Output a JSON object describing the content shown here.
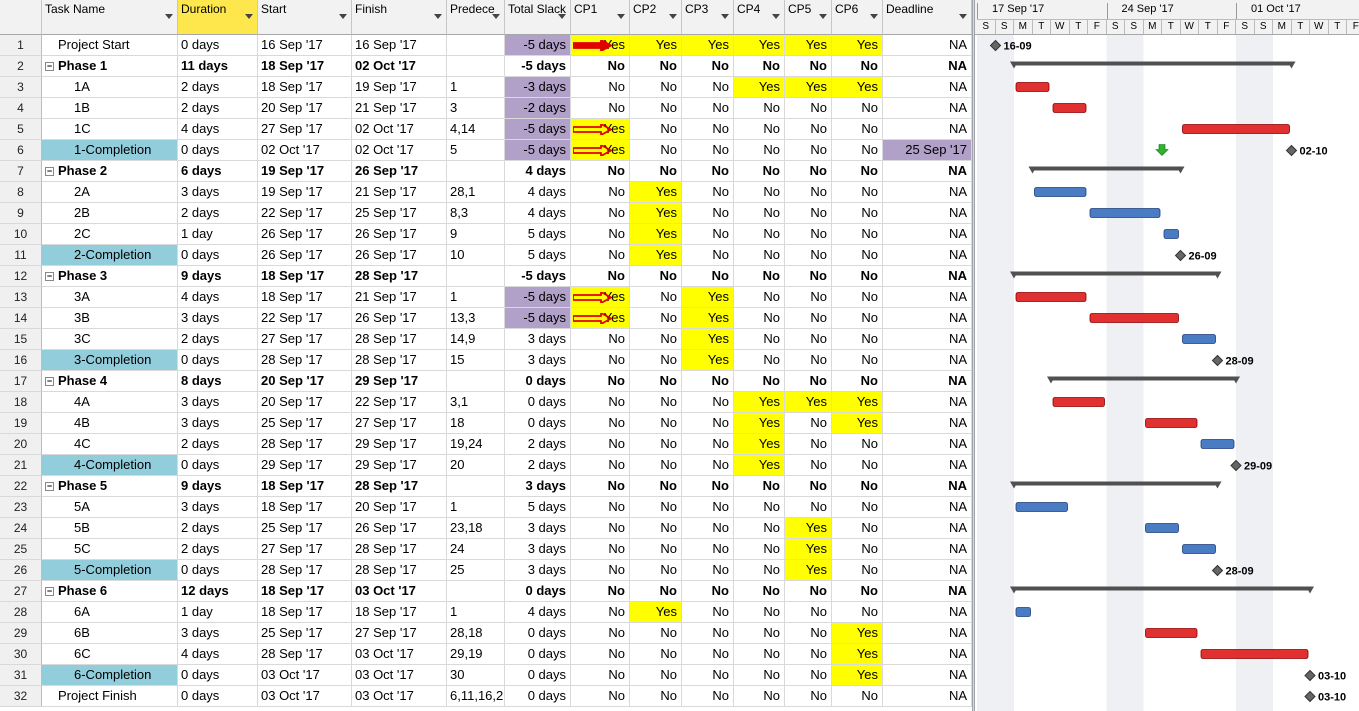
{
  "columns": {
    "id": "",
    "name": "Task Name",
    "duration": "Duration",
    "start": "Start",
    "finish": "Finish",
    "pred": "Predece",
    "slack": "Total Slack",
    "cp1": "CP1",
    "cp2": "CP2",
    "cp3": "CP3",
    "cp4": "CP4",
    "cp5": "CP5",
    "cp6": "CP6",
    "deadline": "Deadline"
  },
  "colors": {
    "yes": "#ffff00",
    "slack_negative": "#b1a0c7",
    "milestone_name": "#92cddc",
    "critical_bar": "#e03030",
    "normal_bar": "#4a7cc4",
    "summary_bar": "#505050"
  },
  "rows": [
    {
      "id": "1",
      "name": "Project Start",
      "dur": "0 days",
      "start": "16 Sep '17",
      "finish": "16 Sep '17",
      "pred": "",
      "slack": "-5 days",
      "cp": [
        "Yes",
        "Yes",
        "Yes",
        "Yes",
        "Yes",
        "Yes"
      ],
      "deadline": "NA"
    },
    {
      "id": "2",
      "name": "Phase 1",
      "dur": "11 days",
      "start": "18 Sep '17",
      "finish": "02 Oct '17",
      "pred": "",
      "slack": "-5 days",
      "cp": [
        "No",
        "No",
        "No",
        "No",
        "No",
        "No"
      ],
      "deadline": "NA"
    },
    {
      "id": "3",
      "name": "1A",
      "dur": "2 days",
      "start": "18 Sep '17",
      "finish": "19 Sep '17",
      "pred": "1",
      "slack": "-3 days",
      "cp": [
        "No",
        "No",
        "No",
        "Yes",
        "Yes",
        "Yes"
      ],
      "deadline": "NA"
    },
    {
      "id": "4",
      "name": "1B",
      "dur": "2 days",
      "start": "20 Sep '17",
      "finish": "21 Sep '17",
      "pred": "3",
      "slack": "-2 days",
      "cp": [
        "No",
        "No",
        "No",
        "No",
        "No",
        "No"
      ],
      "deadline": "NA"
    },
    {
      "id": "5",
      "name": "1C",
      "dur": "4 days",
      "start": "27 Sep '17",
      "finish": "02 Oct '17",
      "pred": "4,14",
      "slack": "-5 days",
      "cp": [
        "Yes",
        "No",
        "No",
        "No",
        "No",
        "No"
      ],
      "deadline": "NA"
    },
    {
      "id": "6",
      "name": "1-Completion",
      "dur": "0 days",
      "start": "02 Oct '17",
      "finish": "02 Oct '17",
      "pred": "5",
      "slack": "-5 days",
      "cp": [
        "Yes",
        "No",
        "No",
        "No",
        "No",
        "No"
      ],
      "deadline": "25 Sep '17"
    },
    {
      "id": "7",
      "name": "Phase 2",
      "dur": "6 days",
      "start": "19 Sep '17",
      "finish": "26 Sep '17",
      "pred": "",
      "slack": "4 days",
      "cp": [
        "No",
        "No",
        "No",
        "No",
        "No",
        "No"
      ],
      "deadline": "NA"
    },
    {
      "id": "8",
      "name": "2A",
      "dur": "3 days",
      "start": "19 Sep '17",
      "finish": "21 Sep '17",
      "pred": "28,1",
      "slack": "4 days",
      "cp": [
        "No",
        "Yes",
        "No",
        "No",
        "No",
        "No"
      ],
      "deadline": "NA"
    },
    {
      "id": "9",
      "name": "2B",
      "dur": "2 days",
      "start": "22 Sep '17",
      "finish": "25 Sep '17",
      "pred": "8,3",
      "slack": "4 days",
      "cp": [
        "No",
        "Yes",
        "No",
        "No",
        "No",
        "No"
      ],
      "deadline": "NA"
    },
    {
      "id": "10",
      "name": "2C",
      "dur": "1 day",
      "start": "26 Sep '17",
      "finish": "26 Sep '17",
      "pred": "9",
      "slack": "5 days",
      "cp": [
        "No",
        "Yes",
        "No",
        "No",
        "No",
        "No"
      ],
      "deadline": "NA"
    },
    {
      "id": "11",
      "name": "2-Completion",
      "dur": "0 days",
      "start": "26 Sep '17",
      "finish": "26 Sep '17",
      "pred": "10",
      "slack": "5 days",
      "cp": [
        "No",
        "Yes",
        "No",
        "No",
        "No",
        "No"
      ],
      "deadline": "NA"
    },
    {
      "id": "12",
      "name": "Phase 3",
      "dur": "9 days",
      "start": "18 Sep '17",
      "finish": "28 Sep '17",
      "pred": "",
      "slack": "-5 days",
      "cp": [
        "No",
        "No",
        "No",
        "No",
        "No",
        "No"
      ],
      "deadline": "NA"
    },
    {
      "id": "13",
      "name": "3A",
      "dur": "4 days",
      "start": "18 Sep '17",
      "finish": "21 Sep '17",
      "pred": "1",
      "slack": "-5 days",
      "cp": [
        "Yes",
        "No",
        "Yes",
        "No",
        "No",
        "No"
      ],
      "deadline": "NA"
    },
    {
      "id": "14",
      "name": "3B",
      "dur": "3 days",
      "start": "22 Sep '17",
      "finish": "26 Sep '17",
      "pred": "13,3",
      "slack": "-5 days",
      "cp": [
        "Yes",
        "No",
        "Yes",
        "No",
        "No",
        "No"
      ],
      "deadline": "NA"
    },
    {
      "id": "15",
      "name": "3C",
      "dur": "2 days",
      "start": "27 Sep '17",
      "finish": "28 Sep '17",
      "pred": "14,9",
      "slack": "3 days",
      "cp": [
        "No",
        "No",
        "Yes",
        "No",
        "No",
        "No"
      ],
      "deadline": "NA"
    },
    {
      "id": "16",
      "name": "3-Completion",
      "dur": "0 days",
      "start": "28 Sep '17",
      "finish": "28 Sep '17",
      "pred": "15",
      "slack": "3 days",
      "cp": [
        "No",
        "No",
        "Yes",
        "No",
        "No",
        "No"
      ],
      "deadline": "NA"
    },
    {
      "id": "17",
      "name": "Phase 4",
      "dur": "8 days",
      "start": "20 Sep '17",
      "finish": "29 Sep '17",
      "pred": "",
      "slack": "0 days",
      "cp": [
        "No",
        "No",
        "No",
        "No",
        "No",
        "No"
      ],
      "deadline": "NA"
    },
    {
      "id": "18",
      "name": "4A",
      "dur": "3 days",
      "start": "20 Sep '17",
      "finish": "22 Sep '17",
      "pred": "3,1",
      "slack": "0 days",
      "cp": [
        "No",
        "No",
        "No",
        "Yes",
        "Yes",
        "Yes"
      ],
      "deadline": "NA"
    },
    {
      "id": "19",
      "name": "4B",
      "dur": "3 days",
      "start": "25 Sep '17",
      "finish": "27 Sep '17",
      "pred": "18",
      "slack": "0 days",
      "cp": [
        "No",
        "No",
        "No",
        "Yes",
        "No",
        "Yes"
      ],
      "deadline": "NA"
    },
    {
      "id": "20",
      "name": "4C",
      "dur": "2 days",
      "start": "28 Sep '17",
      "finish": "29 Sep '17",
      "pred": "19,24",
      "slack": "2 days",
      "cp": [
        "No",
        "No",
        "No",
        "Yes",
        "No",
        "No"
      ],
      "deadline": "NA"
    },
    {
      "id": "21",
      "name": "4-Completion",
      "dur": "0 days",
      "start": "29 Sep '17",
      "finish": "29 Sep '17",
      "pred": "20",
      "slack": "2 days",
      "cp": [
        "No",
        "No",
        "No",
        "Yes",
        "No",
        "No"
      ],
      "deadline": "NA"
    },
    {
      "id": "22",
      "name": "Phase 5",
      "dur": "9 days",
      "start": "18 Sep '17",
      "finish": "28 Sep '17",
      "pred": "",
      "slack": "3 days",
      "cp": [
        "No",
        "No",
        "No",
        "No",
        "No",
        "No"
      ],
      "deadline": "NA"
    },
    {
      "id": "23",
      "name": "5A",
      "dur": "3 days",
      "start": "18 Sep '17",
      "finish": "20 Sep '17",
      "pred": "1",
      "slack": "5 days",
      "cp": [
        "No",
        "No",
        "No",
        "No",
        "No",
        "No"
      ],
      "deadline": "NA"
    },
    {
      "id": "24",
      "name": "5B",
      "dur": "2 days",
      "start": "25 Sep '17",
      "finish": "26 Sep '17",
      "pred": "23,18",
      "slack": "3 days",
      "cp": [
        "No",
        "No",
        "No",
        "No",
        "Yes",
        "No"
      ],
      "deadline": "NA"
    },
    {
      "id": "25",
      "name": "5C",
      "dur": "2 days",
      "start": "27 Sep '17",
      "finish": "28 Sep '17",
      "pred": "24",
      "slack": "3 days",
      "cp": [
        "No",
        "No",
        "No",
        "No",
        "Yes",
        "No"
      ],
      "deadline": "NA"
    },
    {
      "id": "26",
      "name": "5-Completion",
      "dur": "0 days",
      "start": "28 Sep '17",
      "finish": "28 Sep '17",
      "pred": "25",
      "slack": "3 days",
      "cp": [
        "No",
        "No",
        "No",
        "No",
        "Yes",
        "No"
      ],
      "deadline": "NA"
    },
    {
      "id": "27",
      "name": "Phase 6",
      "dur": "12 days",
      "start": "18 Sep '17",
      "finish": "03 Oct '17",
      "pred": "",
      "slack": "0 days",
      "cp": [
        "No",
        "No",
        "No",
        "No",
        "No",
        "No"
      ],
      "deadline": "NA"
    },
    {
      "id": "28",
      "name": "6A",
      "dur": "1 day",
      "start": "18 Sep '17",
      "finish": "18 Sep '17",
      "pred": "1",
      "slack": "4 days",
      "cp": [
        "No",
        "Yes",
        "No",
        "No",
        "No",
        "No"
      ],
      "deadline": "NA"
    },
    {
      "id": "29",
      "name": "6B",
      "dur": "3 days",
      "start": "25 Sep '17",
      "finish": "27 Sep '17",
      "pred": "28,18",
      "slack": "0 days",
      "cp": [
        "No",
        "No",
        "No",
        "No",
        "No",
        "Yes"
      ],
      "deadline": "NA"
    },
    {
      "id": "30",
      "name": "6C",
      "dur": "4 days",
      "start": "28 Sep '17",
      "finish": "03 Oct '17",
      "pred": "29,19",
      "slack": "0 days",
      "cp": [
        "No",
        "No",
        "No",
        "No",
        "No",
        "Yes"
      ],
      "deadline": "NA"
    },
    {
      "id": "31",
      "name": "6-Completion",
      "dur": "0 days",
      "start": "03 Oct '17",
      "finish": "03 Oct '17",
      "pred": "30",
      "slack": "0 days",
      "cp": [
        "No",
        "No",
        "No",
        "No",
        "No",
        "Yes"
      ],
      "deadline": "NA"
    },
    {
      "id": "32",
      "name": "Project Finish",
      "dur": "0 days",
      "start": "03 Oct '17",
      "finish": "03 Oct '17",
      "pred": "6,11,16,2",
      "slack": "0 days",
      "cp": [
        "No",
        "No",
        "No",
        "No",
        "No",
        "No"
      ],
      "deadline": "NA"
    }
  ],
  "gantt": {
    "weeks": [
      "17 Sep '17",
      "24 Sep '17",
      "01 Oct '17"
    ],
    "days": [
      "S",
      "S",
      "M",
      "T",
      "W",
      "T",
      "F",
      "S",
      "S",
      "M",
      "T",
      "W",
      "T",
      "F",
      "S",
      "S",
      "M",
      "T",
      "W",
      "T",
      "F"
    ],
    "milestone_labels": {
      "1": "16-09",
      "6": "02-10",
      "11": "26-09",
      "16": "28-09",
      "21": "29-09",
      "26": "28-09",
      "31": "03-10",
      "32": "03-10"
    }
  }
}
